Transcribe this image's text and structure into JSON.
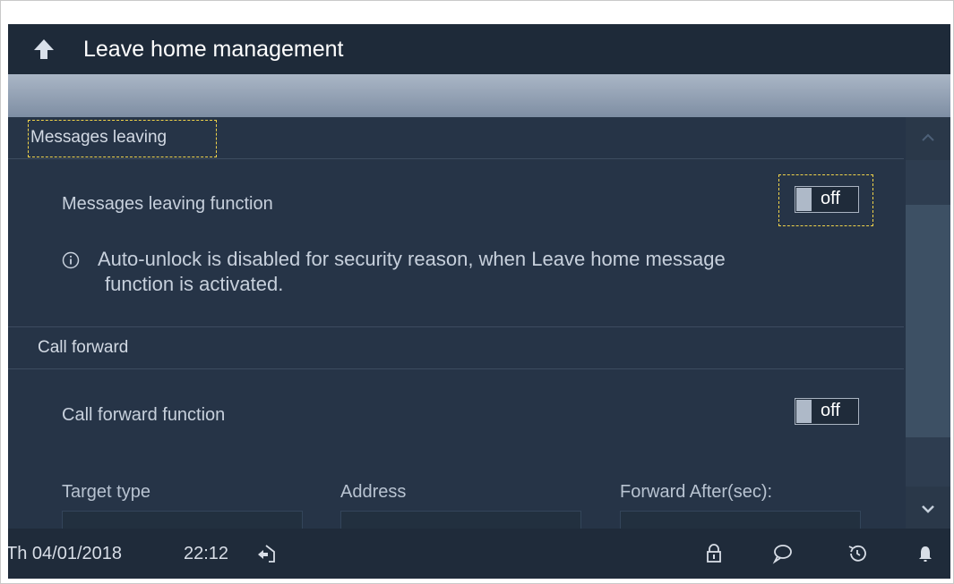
{
  "header": {
    "title": "Leave home management"
  },
  "sections": {
    "messages": {
      "title": "Messages leaving",
      "function_label": "Messages leaving function",
      "toggle_state": "off",
      "info_line1": "Auto-unlock is disabled for security reason, when Leave home message",
      "info_line2": "function is activated."
    },
    "call_forward": {
      "title": "Call forward",
      "function_label": "Call forward function",
      "toggle_state": "off",
      "columns": [
        "Target type",
        "Address",
        "Forward After(sec):"
      ]
    }
  },
  "status": {
    "date": "Th 04/01/2018",
    "time": "22:12",
    "icons": [
      "home-exit-icon",
      "lock-icon",
      "message-icon",
      "history-icon",
      "bell-icon"
    ]
  },
  "colors": {
    "background": "#263447",
    "titlebar": "#1e2a39",
    "focus": "#f0d34a"
  }
}
